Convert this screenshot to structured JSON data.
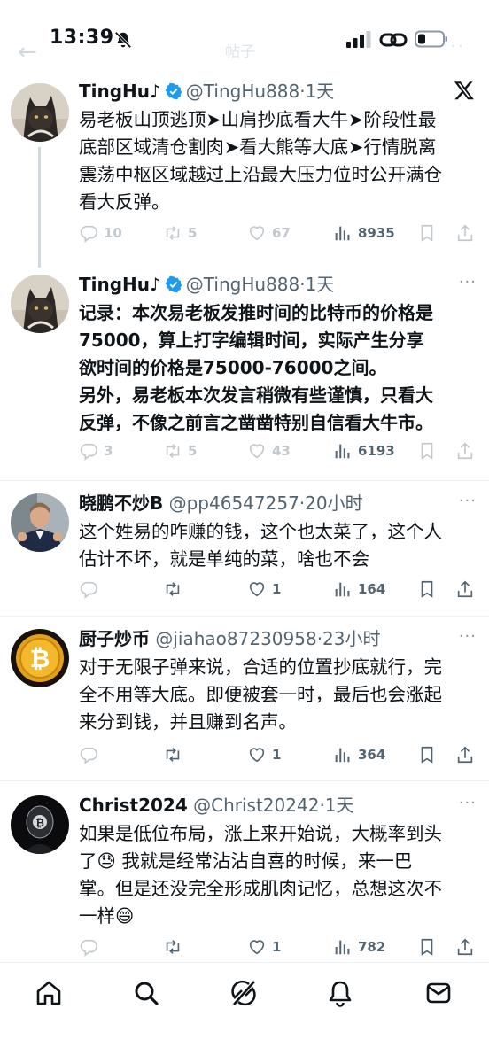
{
  "status_bar": {
    "time": "13:39",
    "ghost_title": "帖子"
  },
  "tweets": [
    {
      "name": "TingHu♪",
      "handle": "@TingHu888",
      "time": "·1天",
      "text": "易老板山顶逃顶➤山肩抄底看大牛➤阶段性最\n底部区域清仓割肉➤看大熊等大底➤行情脱离\n震荡中枢区域越过上沿最大压力位时公开满仓\n看大反弹。",
      "replies": "10",
      "retweets": "5",
      "likes": "67",
      "views": "8935"
    },
    {
      "name": "TingHu♪",
      "handle": "@TingHu888",
      "time": "·1天",
      "text": "记录：本次易老板发推时间的比特币的价格是\n75000，算上打字编辑时间，实际产生分享\n欲时间的价格是75000-76000之间。\n另外，易老板本次发言稍微有些谨慎，只看大\n反弹，不像之前言之凿凿特别自信看大牛市。",
      "replies": "3",
      "retweets": "5",
      "likes": "43",
      "views": "6193"
    },
    {
      "name": "晓鹏不炒B",
      "handle": "@pp46547257",
      "time": "·20小时",
      "text": "这个姓易的咋赚的钱，这个也太菜了，这个人\n估计不坏，就是单纯的菜，啥也不会",
      "likes": "1",
      "views": "164"
    },
    {
      "name": "厨子炒币",
      "handle": "@jiahao87230958",
      "time": "·23小时",
      "text": "对于无限子弹来说，合适的位置抄底就行，完\n全不用等大底。即便被套一时，最后也会涨起\n来分到钱，并且赚到名声。",
      "likes": "1",
      "views": "364"
    },
    {
      "name": "Christ2024",
      "handle": "@Christ20242",
      "time": "·1天",
      "text": "如果是低位布局，涨上来开始说，大概率到头\n了😓 我就是经常沾沾自喜的时候，来一巴\n掌。但是还没完全形成肌肉记忆，总想这次不\n一样😄",
      "likes": "1",
      "views": "782"
    }
  ],
  "icons": {
    "nav": [
      "home-icon",
      "search-icon",
      "grok-icon",
      "notifications-icon",
      "messages-icon"
    ],
    "accent": "#1d9bf0"
  }
}
